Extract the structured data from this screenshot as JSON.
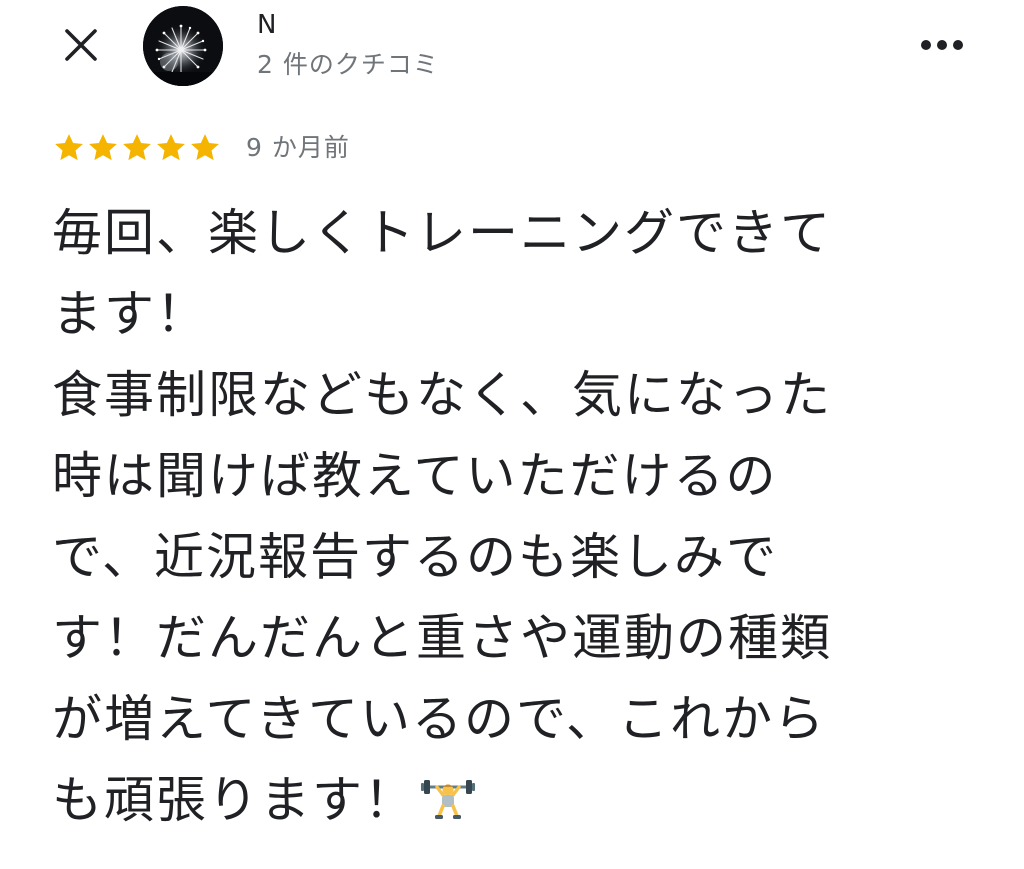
{
  "header": {
    "close_icon": "close-icon",
    "author_name": "N",
    "review_count": "2 件のクチコミ",
    "more_icon": "more-horizontal-icon"
  },
  "rating": {
    "stars": 5,
    "max_stars": 5,
    "star_color": "#f4b400",
    "date": "9 か月前"
  },
  "review": {
    "lines": [
      "毎回、楽しくトレーニングできて",
      "ます！",
      "食事制限などもなく、気になった",
      "時は聞けば教えていただけるの",
      "で、近況報告するのも楽しみで",
      "す！だんだんと重さや運動の種類",
      "が増えてきているので、これから",
      "も頑張ります！"
    ],
    "emoji": "weightlifter-emoji"
  }
}
